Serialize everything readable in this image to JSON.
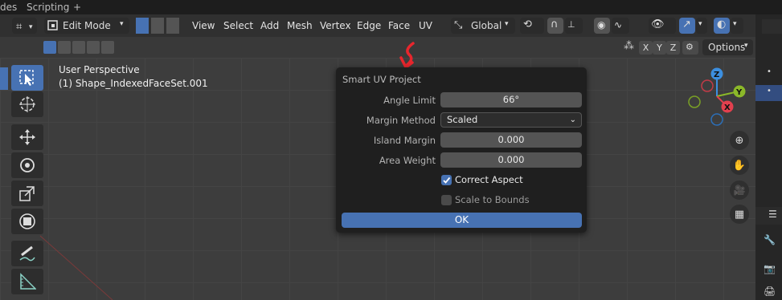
{
  "tabs": [
    "des",
    "Scripting",
    "+"
  ],
  "header": {
    "mode": "Edit Mode",
    "menus": [
      "View",
      "Select",
      "Add",
      "Mesh",
      "Vertex",
      "Edge",
      "Face",
      "UV"
    ],
    "transform_orientation": "Global",
    "options_label": "Options",
    "axes": [
      "X",
      "Y",
      "Z"
    ]
  },
  "viewport": {
    "view_title": "User Perspective",
    "object_name": "(1) Shape_IndexedFaceSet.001"
  },
  "dialog": {
    "title": "Smart UV Project",
    "angle_limit_label": "Angle Limit",
    "angle_limit_value": "66°",
    "margin_method_label": "Margin Method",
    "margin_method_value": "Scaled",
    "island_margin_label": "Island Margin",
    "island_margin_value": "0.000",
    "area_weight_label": "Area Weight",
    "area_weight_value": "0.000",
    "correct_aspect_label": "Correct Aspect",
    "correct_aspect_checked": true,
    "scale_to_bounds_label": "Scale to Bounds",
    "scale_to_bounds_checked": false,
    "ok_label": "OK"
  },
  "gizmo": {
    "z": "Z",
    "y": "Y",
    "x": "X"
  },
  "colors": {
    "accent": "#4772b3",
    "x_axis": "#e2404e",
    "y_axis": "#8bb829",
    "z_axis": "#3c8fe0",
    "annotation": "#e8262d"
  }
}
